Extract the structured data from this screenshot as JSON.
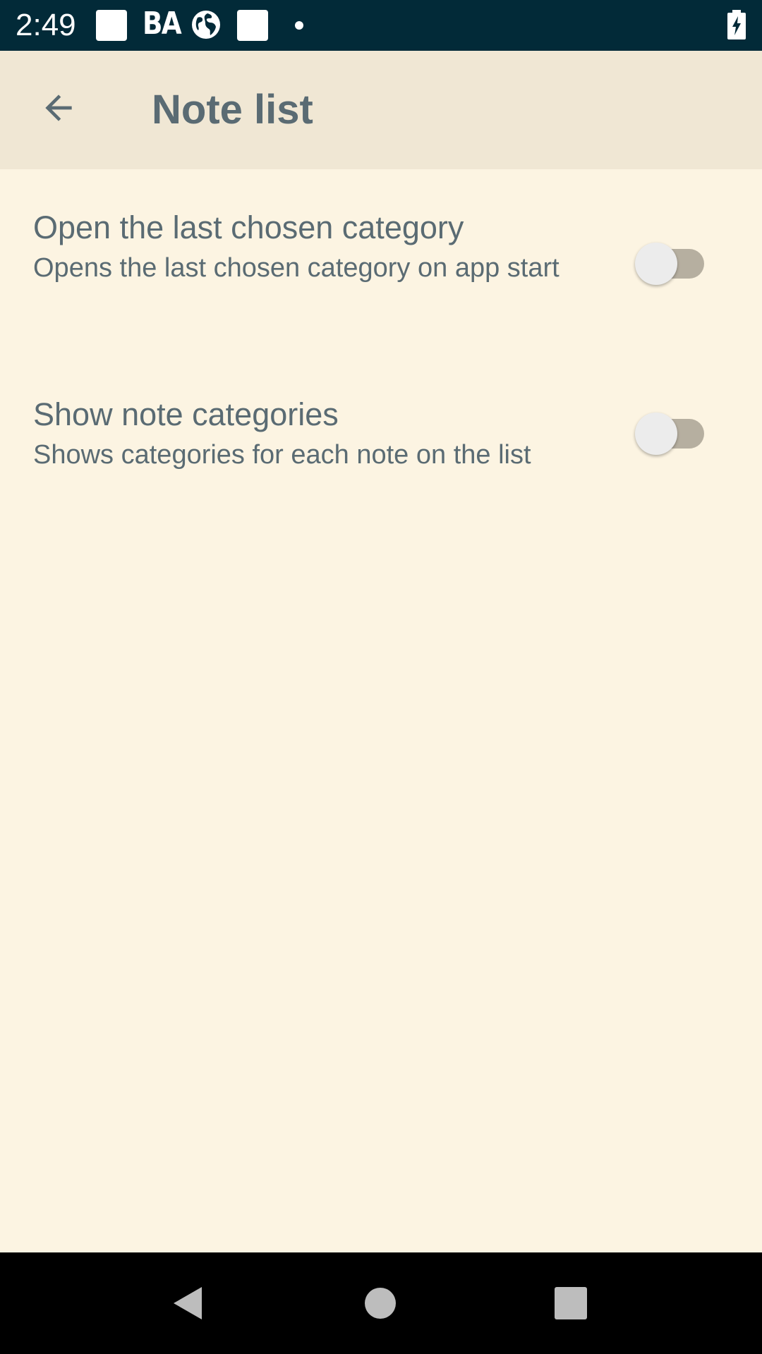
{
  "status_bar": {
    "time": "2:49",
    "carrier_text": "BA",
    "icons": [
      "notification-square-icon",
      "globe-icon",
      "notification-square-icon",
      "dot-icon",
      "battery-charging-icon"
    ]
  },
  "app_bar": {
    "title": "Note list",
    "back_icon": "arrow-back-icon"
  },
  "preferences": [
    {
      "title": "Open the last chosen category",
      "summary": "Opens the last chosen category on app start",
      "enabled": false
    },
    {
      "title": "Show note categories",
      "summary": "Shows categories for each note on the list",
      "enabled": false
    }
  ],
  "nav_bar": {
    "buttons": [
      "back-triangle-icon",
      "home-circle-icon",
      "recents-square-icon"
    ]
  },
  "colors": {
    "status_bar": "#022a38",
    "app_bar": "#f0e7d4",
    "background": "#fcf4e2",
    "text": "#5a6b73",
    "switch_track_off": "#b6afa0",
    "switch_thumb_off": "#ececec"
  }
}
